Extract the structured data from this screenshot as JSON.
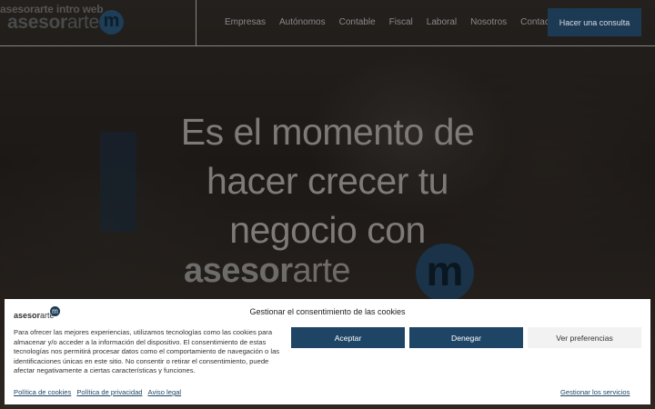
{
  "header": {
    "logo_alt": "asesorarte intro web",
    "logo_bold": "asesor",
    "logo_light": "arte",
    "logo_mark": "m",
    "nav": [
      "Empresas",
      "Autónomos",
      "Contable",
      "Fiscal",
      "Laboral",
      "Nosotros",
      "Contacto"
    ],
    "cta_label": "Hacer una consulta"
  },
  "hero": {
    "title_lines": [
      "Es el momento de",
      "hacer crecer tu",
      "negocio con"
    ],
    "brand_bold": "asesor",
    "brand_light": "arte",
    "brand_mark": "m"
  },
  "cookie": {
    "logo_bold": "asesor",
    "logo_light": "arte",
    "logo_mark": "m",
    "title": "Gestionar el consentimiento de las cookies",
    "text": "Para ofrecer las mejores experiencias, utilizamos tecnologías como las cookies para almacenar y/o acceder a la información del dispositivo. El consentimiento de estas tecnologías nos permitirá procesar datos como el comportamiento de navegación o las identificaciones únicas en este sitio. No consentir o retirar el consentimiento, puede afectar negativamente a ciertas características y funciones.",
    "accept_label": "Aceptar",
    "deny_label": "Denegar",
    "prefs_label": "Ver preferencias",
    "links": [
      "Política de cookies",
      "Política de privacidad",
      "Aviso legal"
    ],
    "manage_label": "Gestionar los servicios"
  },
  "colors": {
    "brand_blue": "#1e4566",
    "header_cta_bg": "#1c3a54",
    "banner_bg": "#ffffff"
  }
}
